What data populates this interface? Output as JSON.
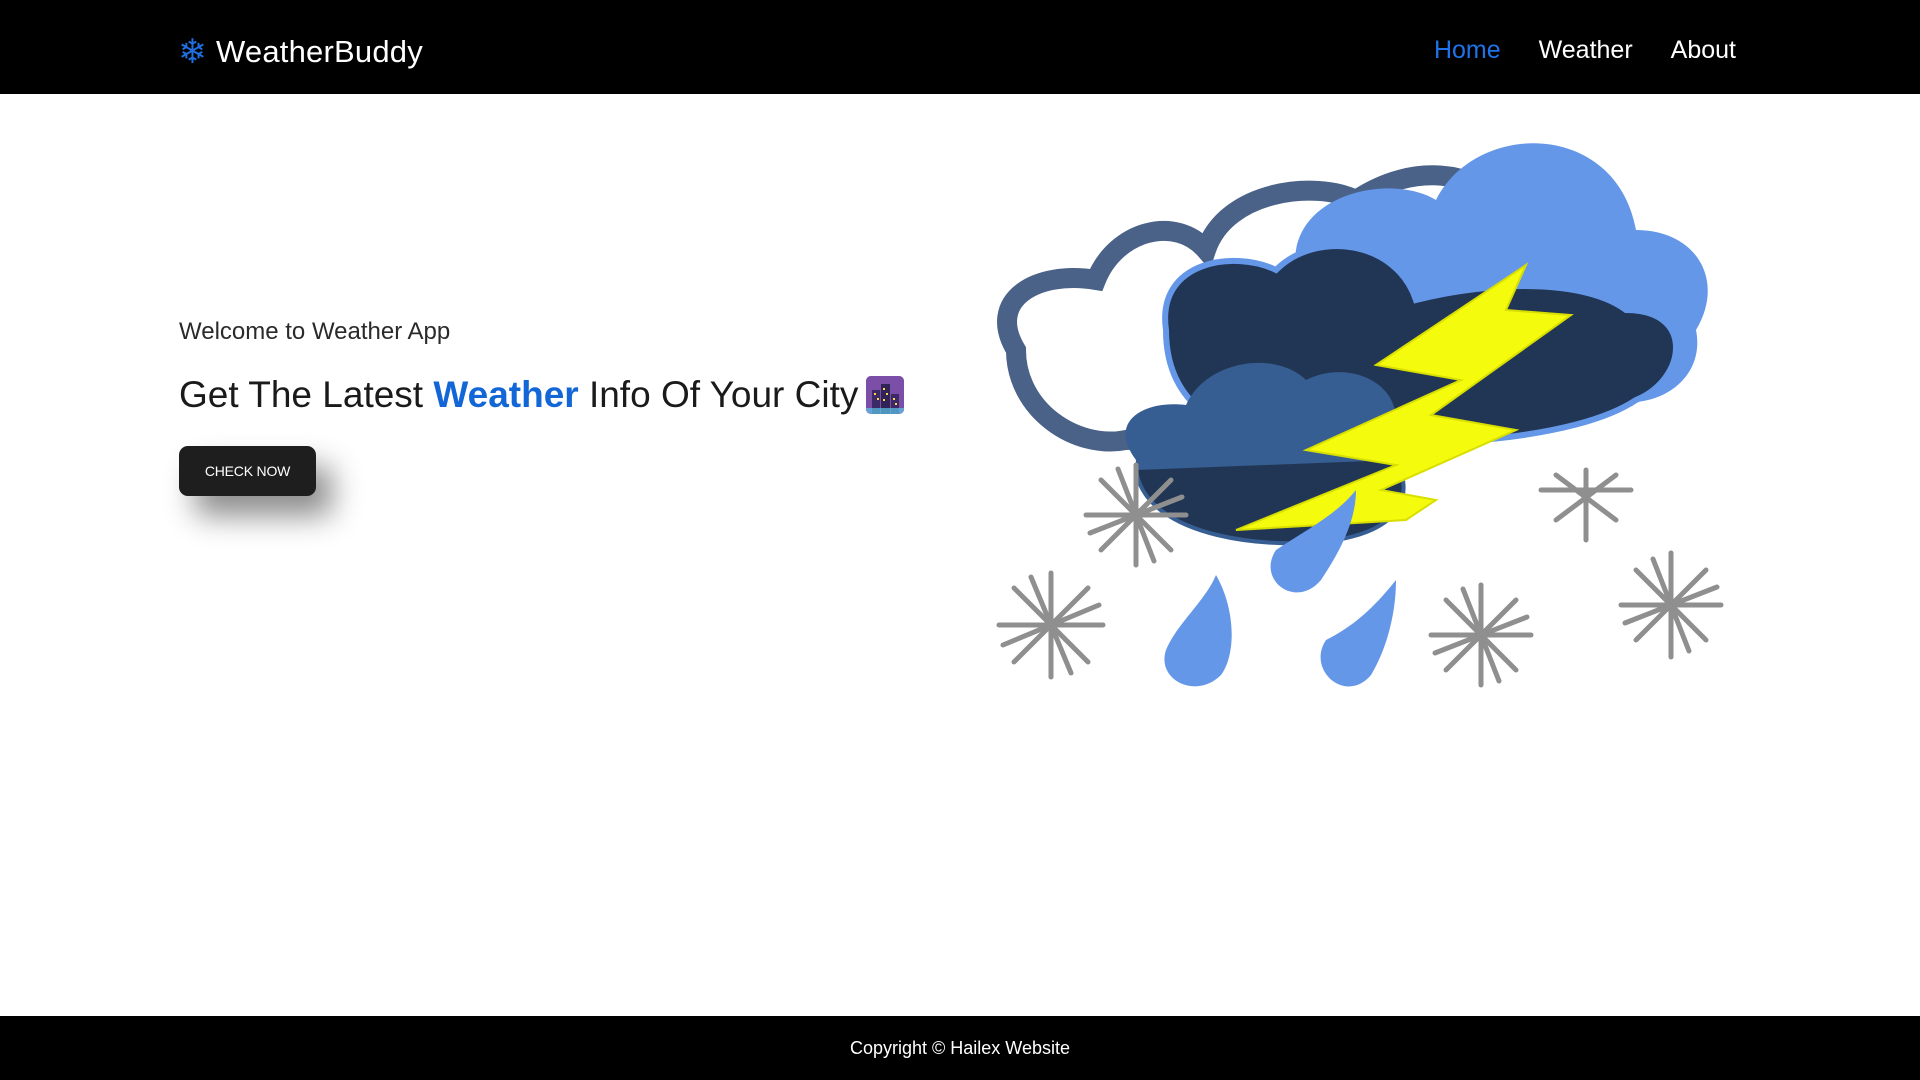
{
  "navbar": {
    "brand_icon": "snowflake-icon",
    "brand_name": "WeatherBuddy",
    "links": [
      {
        "label": "Home",
        "active": true
      },
      {
        "label": "Weather",
        "active": false
      },
      {
        "label": "About",
        "active": false
      }
    ]
  },
  "hero": {
    "subtitle": "Welcome to Weather App",
    "title_prefix": "Get The Latest ",
    "title_accent": "Weather",
    "title_suffix": " Info Of Your City",
    "title_emoji": "city-at-night-icon",
    "cta_label": "CHECK NOW"
  },
  "carousel": {
    "next_icon": "chevron-right-icon"
  },
  "footer": {
    "copyright": "Copyright © Hailex Website"
  },
  "colors": {
    "nav_bg": "#000000",
    "accent": "#1f73e8",
    "button_bg": "#1e1e1e",
    "footer_bg": "#000000"
  }
}
